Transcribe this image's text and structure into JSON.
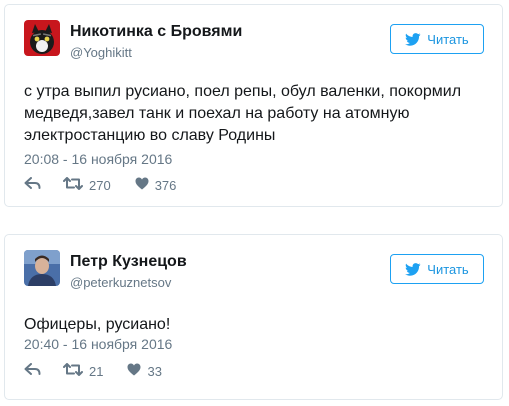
{
  "colors": {
    "accent": "#1da1f2",
    "text": "#14171a",
    "muted": "#657786",
    "border": "#e1e8ed"
  },
  "tweets": [
    {
      "name": "Никотинка с Бровями",
      "handle": "@Yoghikitt",
      "follow_label": "Читать",
      "text": "с утра выпил русиано, поел репы, обул валенки, покормил медведя,завел танк и поехал на работу на атомную электростанцию во славу Родины",
      "time": "20:08 - 16 ноября 2016",
      "retweets": "270",
      "likes": "376",
      "icons": {
        "follow": "twitter-bird-icon",
        "reply": "reply-icon",
        "retweet": "retweet-icon",
        "like": "heart-icon"
      }
    },
    {
      "name": "Петр Кузнецов",
      "handle": "@peterkuznetsov",
      "follow_label": "Читать",
      "text": "Офицеры, русиано!",
      "time": "20:40 - 16 ноября 2016",
      "retweets": "21",
      "likes": "33",
      "icons": {
        "follow": "twitter-bird-icon",
        "reply": "reply-icon",
        "retweet": "retweet-icon",
        "like": "heart-icon"
      }
    }
  ]
}
